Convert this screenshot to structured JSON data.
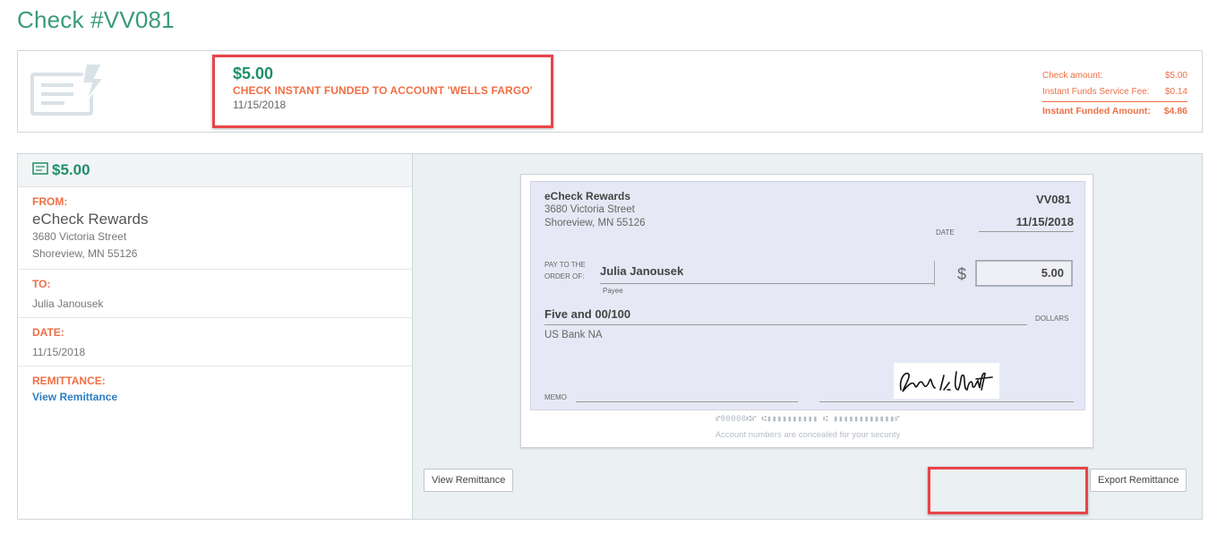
{
  "page": {
    "title": "Check #VV081"
  },
  "summary": {
    "amount": "$5.00",
    "status": "CHECK INSTANT FUNDED TO ACCOUNT 'WELLS FARGO'",
    "date": "11/15/2018",
    "fees": [
      {
        "label": "Check amount:",
        "value": "$5.00"
      },
      {
        "label": "Instant Funds Service Fee:",
        "value": "$0.14"
      }
    ],
    "total": {
      "label": "Instant Funded Amount:",
      "value": "$4.86"
    }
  },
  "details": {
    "amount": "$5.00",
    "from_label": "FROM:",
    "from_name": "eCheck Rewards",
    "from_addr1": "3680 Victoria Street",
    "from_addr2": "Shoreview, MN 55126",
    "to_label": "TO:",
    "to_name": "Julia Janousek",
    "date_label": "DATE:",
    "date": "11/15/2018",
    "remit_label": "REMITTANCE:",
    "remit_link": "View Remittance"
  },
  "check": {
    "payer": "eCheck Rewards",
    "addr1": "3680 Victoria Street",
    "addr2": "Shoreview, MN 55126",
    "number": "VV081",
    "date_label": "DATE",
    "date": "11/15/2018",
    "pay_label_1": "PAY TO THE",
    "pay_label_2": "ORDER OF:",
    "payee": "Julia Janousek",
    "payee_label": "Payee",
    "dollar_sign": "$",
    "amount": "5.00",
    "amount_words": "Five and 00/100",
    "dollars_label": "DOLLARS",
    "bank": "US Bank NA",
    "memo_label": "MEMO",
    "micr": "⑈00008⑆⑈ ⑆▮▮▮▮▮▮▮▮▮▮ ⑆ ▮▮▮▮▮▮▮▮▮▮▮▮⑈",
    "conceal_note": "Account numbers are concealed for your security"
  },
  "buttons": {
    "view_remittance": "View Remittance",
    "export_remittance": "Export Remittance"
  },
  "colors": {
    "accent_green": "#1f8f6b",
    "accent_orange": "#ef6f45",
    "highlight_red": "#e8444a",
    "link_blue": "#2f7fc1"
  }
}
